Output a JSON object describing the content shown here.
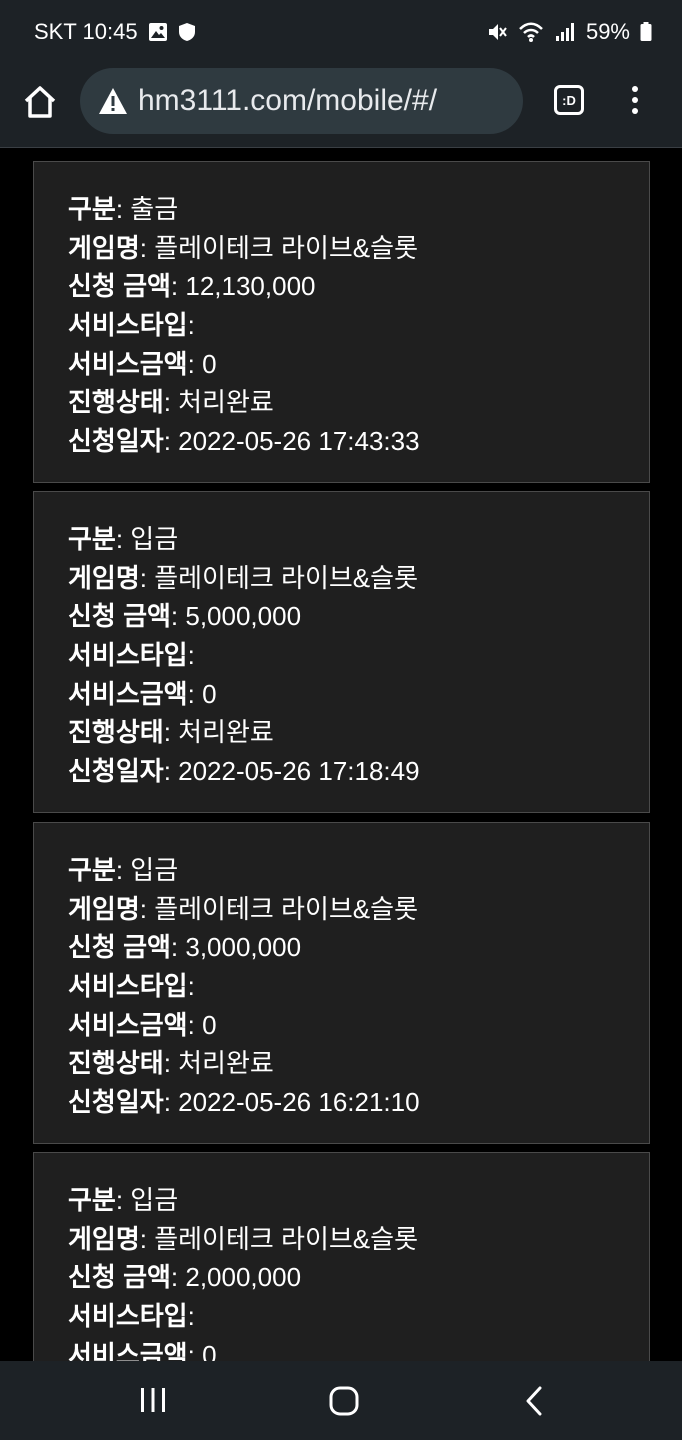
{
  "status_bar": {
    "carrier_time": "SKT 10:45",
    "battery": "59%"
  },
  "browser": {
    "url": "hm3111.com/mobile/#/",
    "tabs_label": ":D"
  },
  "labels": {
    "type": "구분",
    "game": "게임명",
    "amount": "신청 금액",
    "service_type": "서비스타입",
    "service_amount": "서비스금액",
    "status": "진행상태",
    "date": "신청일자"
  },
  "records": [
    {
      "type": "출금",
      "game": "플레이테크 라이브&슬롯",
      "amount": "12,130,000",
      "service_type": "",
      "service_amount": "0",
      "status": "처리완료",
      "date": "2022-05-26 17:43:33"
    },
    {
      "type": "입금",
      "game": "플레이테크 라이브&슬롯",
      "amount": "5,000,000",
      "service_type": "",
      "service_amount": "0",
      "status": "처리완료",
      "date": "2022-05-26 17:18:49"
    },
    {
      "type": "입금",
      "game": "플레이테크 라이브&슬롯",
      "amount": "3,000,000",
      "service_type": "",
      "service_amount": "0",
      "status": "처리완료",
      "date": "2022-05-26 16:21:10"
    },
    {
      "type": "입금",
      "game": "플레이테크 라이브&슬롯",
      "amount": "2,000,000",
      "service_type": "",
      "service_amount": "0"
    }
  ]
}
